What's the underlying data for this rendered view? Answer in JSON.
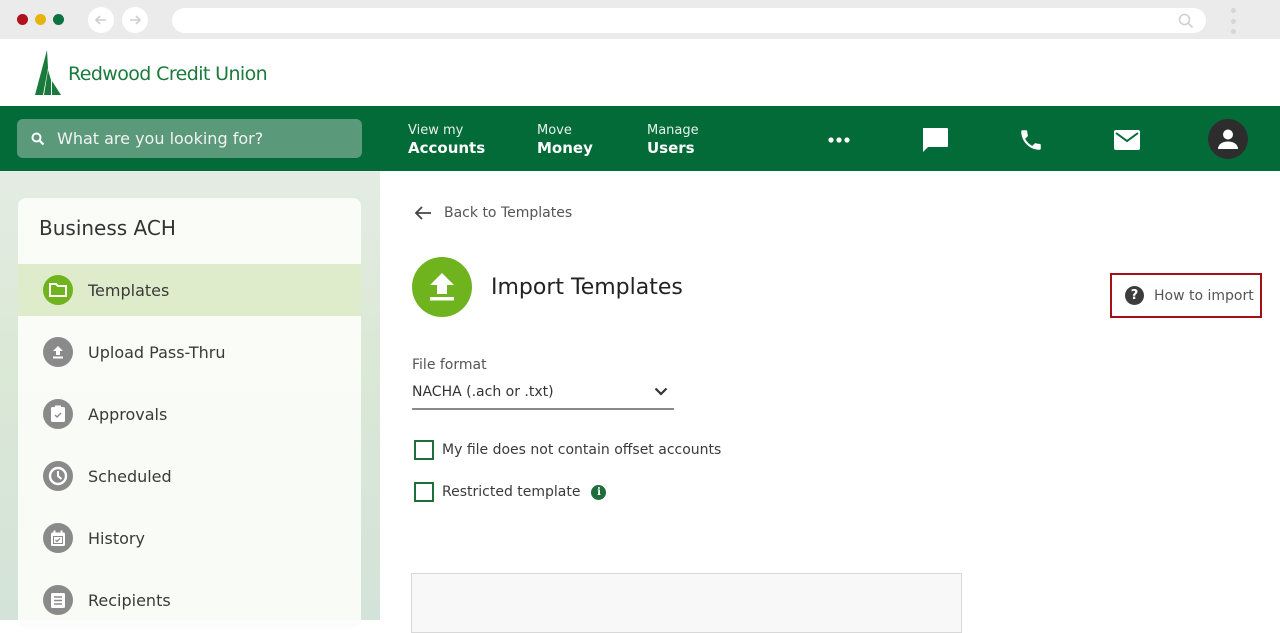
{
  "browser": {
    "back_icon": "arrow-left-icon",
    "forward_icon": "arrow-right-icon",
    "url": "",
    "search_icon": "search-icon",
    "menu_icon": "kebab-icon"
  },
  "brand": {
    "name": "Redwood Credit Union",
    "logo_icon": "redwood-tree-logo",
    "primary_color": "#036b38",
    "accent_color": "#6fb31e"
  },
  "topnav": {
    "search_placeholder": "What are you looking for?",
    "items": [
      {
        "top": "View my",
        "bottom": "Accounts"
      },
      {
        "top": "Move",
        "bottom": "Money"
      },
      {
        "top": "Manage",
        "bottom": "Users"
      }
    ],
    "icons": [
      "more-icon",
      "chat-icon",
      "phone-icon",
      "mail-icon",
      "user-avatar-icon"
    ]
  },
  "sidebar": {
    "title": "Business ACH",
    "items": [
      {
        "label": "Templates",
        "icon": "folder-icon",
        "active": true
      },
      {
        "label": "Upload Pass-Thru",
        "icon": "upload-icon",
        "active": false
      },
      {
        "label": "Approvals",
        "icon": "clipboard-check-icon",
        "active": false
      },
      {
        "label": "Scheduled",
        "icon": "clock-icon",
        "active": false
      },
      {
        "label": "History",
        "icon": "calendar-check-icon",
        "active": false
      },
      {
        "label": "Recipients",
        "icon": "list-icon",
        "active": false
      }
    ]
  },
  "main": {
    "back_label": "Back to Templates",
    "title": "Import Templates",
    "title_icon": "upload-icon",
    "help_label": "How to import",
    "help_icon": "question-icon",
    "file_format": {
      "label": "File format",
      "value": "NACHA (.ach or .txt)"
    },
    "checkboxes": [
      {
        "label": "My file does not contain offset accounts",
        "checked": false
      },
      {
        "label": "Restricted template",
        "checked": false,
        "info_icon": true
      }
    ],
    "highlight_color": "#a31015"
  }
}
